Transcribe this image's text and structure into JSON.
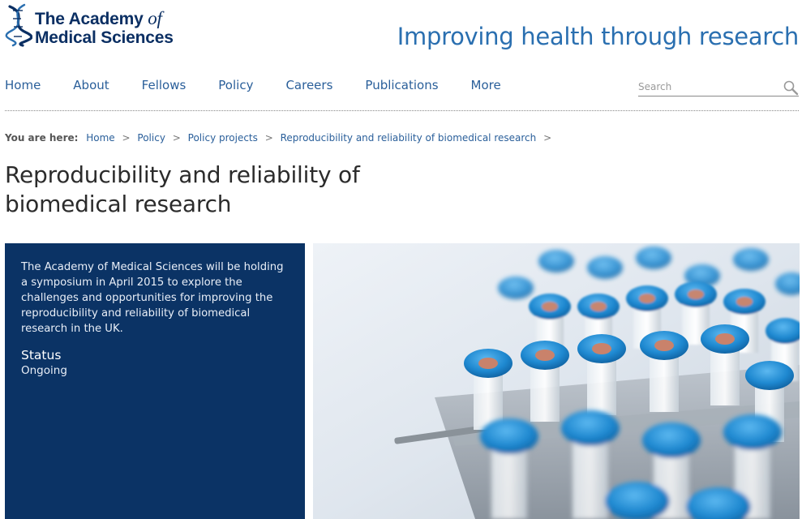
{
  "header": {
    "logo_line1": "The Academy",
    "logo_of": "of",
    "logo_line2": "Medical Sciences",
    "tagline": "Improving health through research"
  },
  "nav": {
    "items": [
      {
        "label": "Home"
      },
      {
        "label": "About"
      },
      {
        "label": "Fellows"
      },
      {
        "label": "Policy"
      },
      {
        "label": "Careers"
      },
      {
        "label": "Publications"
      },
      {
        "label": "More"
      }
    ],
    "search_placeholder": "Search"
  },
  "breadcrumb": {
    "lead": "You are here:",
    "items": [
      "Home",
      "Policy",
      "Policy projects",
      "Reproducibility and reliability of biomedical research"
    ],
    "separator": ">"
  },
  "page": {
    "title": "Reproducibility and reliability of biomedical research"
  },
  "panel": {
    "description": "The Academy of Medical Sciences will be holding a symposium in April 2015 to explore the challenges and opportunities for improving the reproducibility and reliability of biomedical research in the UK.",
    "status_heading": "Status",
    "status_value": "Ongoing"
  },
  "colors": {
    "brand_navy": "#0b3365",
    "link_blue": "#2a5f9a",
    "tagline_blue": "#2a6fb0",
    "vial_cap_blue": "#1e88d0"
  },
  "icons": {
    "logo_mark": "dna-helix-icon",
    "search": "magnifier-icon"
  }
}
